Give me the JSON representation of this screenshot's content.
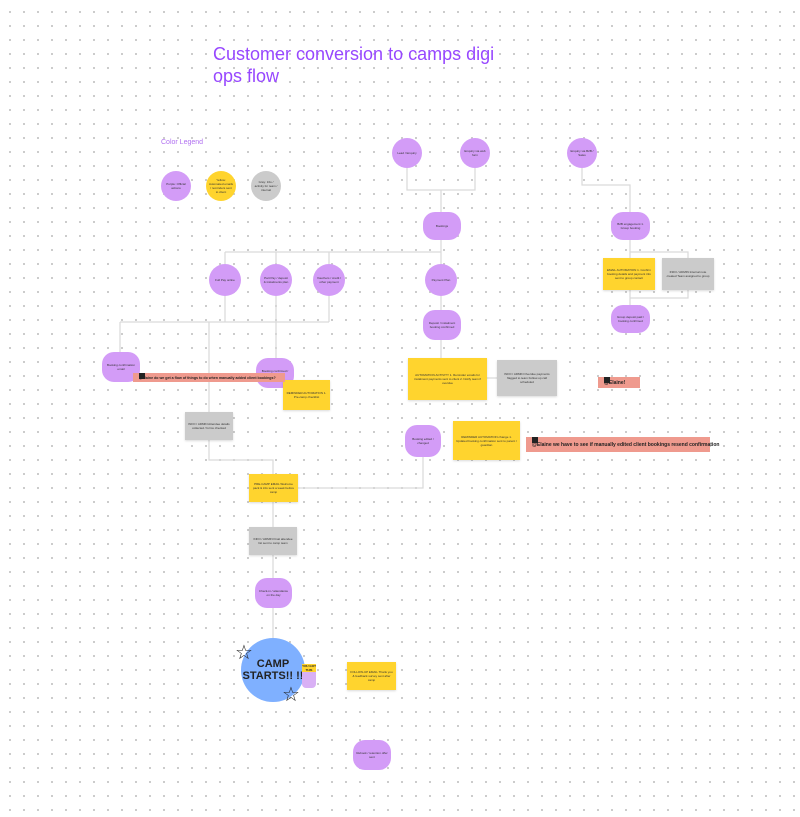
{
  "title": "Customer conversion to camps digi ops flow",
  "legend": {
    "title": "Color Legend",
    "items": [
      {
        "label": "Purple: Official actions",
        "color": "#d39cf7"
      },
      {
        "label": "Yellow: Automated emails / reminders sent to client",
        "color": "#ffd42e"
      },
      {
        "label": "Gray: Info / activity for team / internal",
        "color": "#cbcbcb"
      }
    ]
  },
  "nodes": {
    "top1": "Lead / Enquiry",
    "top2": "Enquiry via web form",
    "top3": "Enquiry via B2B / Sales",
    "booking": "Bookings",
    "b2b_step": "B2B engagement\n1. Group booking",
    "b2b_yellow": "EMAIL AUTOMATION\n1. Confirm booking details and payment info sent to group contact",
    "b2b_gray": "INFO / ADMIN\nInternal note created\nTeam assigned to group",
    "b2b_final": "Group deposit paid / booking confirmed",
    "opt1": "Full Pay online",
    "opt2": "Part Pay / deposit & instalments plan",
    "opt3": "Vouchers / credit / other payment",
    "opt4": "Payment Plan",
    "plan_step": "Deposit / instalment booking confirmed",
    "plan_yellow": "AUTOMATION ACTIVITY\n1. Reminder emails for instalment payments sent to client\n2. Notify team if overdue",
    "plan_gray": "INFO / ADMIN\nOverdue payments flagged to team\nFollow-up call scheduled",
    "left_step": "Booking confirmation email",
    "mid_step": "Booking confirmed / paid",
    "mid_yellow": "REMINDER AUTOMATION\n1. Pre-camp checklist",
    "gray_mid": "INFO / ADMIN\nAttendee details collected / forms checked",
    "right_step": "Booking edited / changed",
    "right_yellow": "REMINDER AUTOMATION change\n1. Updated booking confirmation sent to parent / guardian",
    "precamp": "PRE-CAMP EMAIL\nWelcome pack & info sent a week before camp",
    "info2": "INFO / ADMIN\nFinal attendee list sent to camp team",
    "checkin": "Check-in / attendance on the day",
    "camp": "CAMP STARTS!! !!",
    "post_yellow": "FOLLOW-UP EMAIL\nThank you & feedback survey sent after camp",
    "final": "Rebook / retention offer sent"
  },
  "comments": {
    "c1": "@Elaine do we get a flow of things to do when manually added client bookings?",
    "c2": "@Elaine!",
    "c3": "@Elaine we have to see if manually edited client bookings resend confirmation"
  },
  "sticker": "YOU GOT THIS"
}
